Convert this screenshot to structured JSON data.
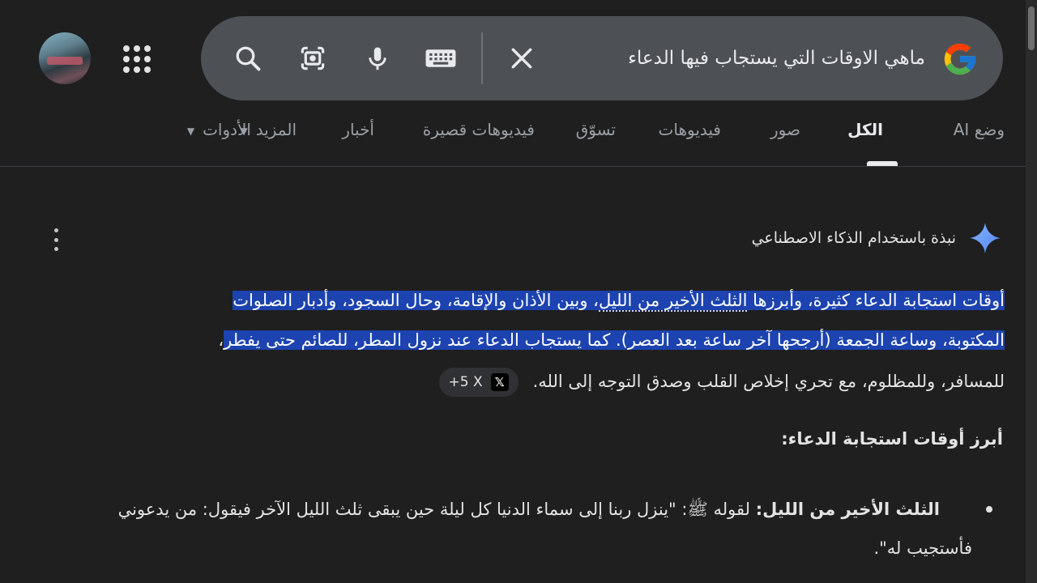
{
  "search": {
    "query": "ماهي الاوقات التي يستجاب فيها الدعاء"
  },
  "icons": {
    "search": "search-icon",
    "lens": "google-lens-icon",
    "mic": "microphone-icon",
    "keyboard": "keyboard-icon",
    "clear": "close-icon",
    "apps": "apps-grid-icon",
    "sparkle": "ai-sparkle-icon",
    "more": "more-vertical-icon"
  },
  "tabs": [
    {
      "label": "وضع AI",
      "active": false
    },
    {
      "label": "الكل",
      "active": true
    },
    {
      "label": "صور",
      "active": false
    },
    {
      "label": "فيديوهات",
      "active": false
    },
    {
      "label": "تسوّق",
      "active": false
    },
    {
      "label": "فيديوهات قصيرة",
      "active": false
    },
    {
      "label": "أخبار",
      "active": false
    },
    {
      "label": "المزيد",
      "active": false
    },
    {
      "label": "الأدوات",
      "active": false
    }
  ],
  "ai_overview": {
    "label": "نبذة باستخدام الذكاء الاصطناعي",
    "line1_a": "أوقات استجابة الدعاء كثيرة، وأبرزها ",
    "line1_link": "الثلث الأخير من الليل",
    "line1_b": "، وبين الأذان والإقامة، وحال السجود، وأدبار الصلوات",
    "line2_hl": "المكتوبة، وساعة الجمعة (أرجحها آخر ساعة بعد العصر). كما يستجاب الدعاء عند نزول المطر، للصائم حتى يفطر",
    "line2_tail": "،",
    "line3": "للمسافر، وللمظلوم، مع تحري إخلاص القلب وصدق التوجه إلى الله.",
    "chip_count": "+5",
    "chip_source": "X",
    "heading": "أبرز أوقات استجابة الدعاء:",
    "bullet_title": "الثلث الأخير من الليل:",
    "bullet_text": " لقوله ﷺ: \"ينزل ربنا إلى سماء الدنيا كل ليلة حين يبقى ثلث الليل الآخر فيقول: من يدعوني",
    "bullet_text2": "فأستجيب له\"."
  },
  "colors": {
    "background": "#1f1f1f",
    "searchbar": "#4d5156",
    "highlight": "#1c43b0"
  }
}
